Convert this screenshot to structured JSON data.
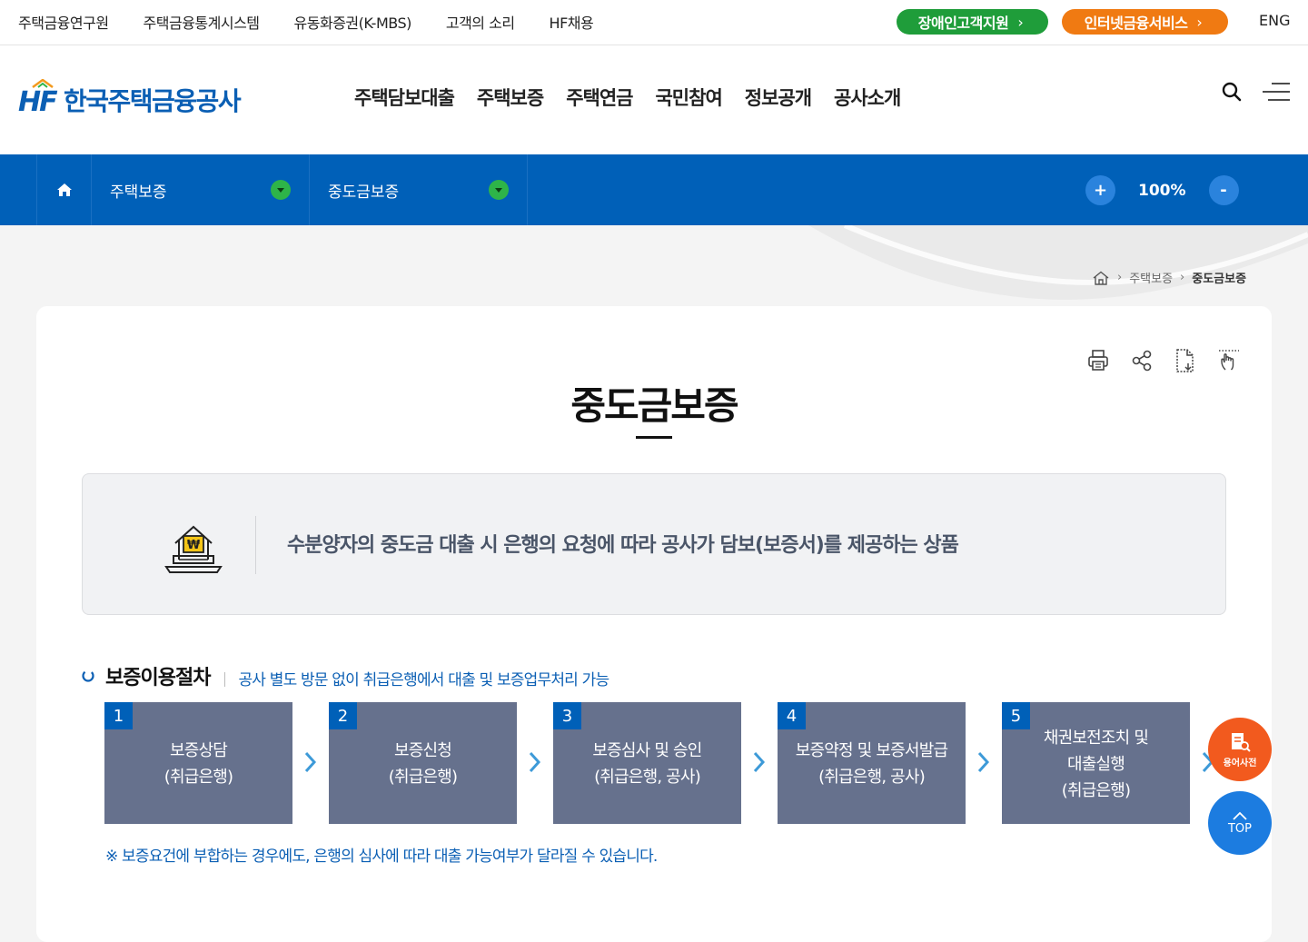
{
  "topbar": {
    "links": [
      "주택금융연구원",
      "주택금융통계시스템",
      "유동화증권(K-MBS)",
      "고객의 소리",
      "HF채용"
    ],
    "accessibility_label": "장애인고객지원",
    "internet_banking_label": "인터넷금융서비스",
    "lang_label": "ENG"
  },
  "header": {
    "logo_mark": "HF",
    "logo_name": "한국주택금융공사",
    "nav": [
      "주택담보대출",
      "주택보증",
      "주택연금",
      "국민참여",
      "정보공개",
      "공사소개"
    ]
  },
  "locbar": {
    "depth1": "주택보증",
    "depth2": "중도금보증",
    "zoom_in": "+",
    "zoom_value": "100%",
    "zoom_out": "-"
  },
  "breadcrumb": {
    "level1": "주택보증",
    "current": "중도금보증"
  },
  "page": {
    "title": "중도금보증",
    "intro": "수분양자의 중도금 대출 시 은행의 요청에 따라 공사가 담보(보증서)를 제공하는 상품"
  },
  "procedure": {
    "heading": "보증이용절차",
    "subheading": "공사 별도 방문 없이 취급은행에서 대출 및 보증업무처리 가능",
    "steps": [
      {
        "num": "1",
        "line1": "보증상담",
        "line2": "(취급은행)",
        "line3": ""
      },
      {
        "num": "2",
        "line1": "보증신청",
        "line2": "(취급은행)",
        "line3": ""
      },
      {
        "num": "3",
        "line1": "보증심사 및 승인",
        "line2": "(취급은행, 공사)",
        "line3": ""
      },
      {
        "num": "4",
        "line1": "보증약정 및 보증서발급",
        "line2": "(취급은행, 공사)",
        "line3": ""
      },
      {
        "num": "5",
        "line1": "채권보전조치 및",
        "line2": "대출실행",
        "line3": "(취급은행)"
      }
    ],
    "note": "※ 보증요건에 부합하는 경우에도, 은행의 심사에 따라 대출 가능여부가 달라질 수 있습니다."
  },
  "floating": {
    "dictionary_label": "용어사전",
    "top_label": "TOP"
  },
  "colors": {
    "brand_blue": "#0060b8",
    "green_pill": "#1f9d3a",
    "orange_pill": "#f07a12",
    "step_box": "#66718d",
    "dropdown_green": "#2eb449"
  },
  "icons": {
    "home": "home-icon",
    "dropdown": "chevron-down-icon",
    "search": "search-icon",
    "menu": "hamburger-menu-icon",
    "print": "print-icon",
    "share": "share-icon",
    "download": "file-download-icon",
    "touch": "touch-hand-icon",
    "intro": "house-won-laptop-icon"
  }
}
